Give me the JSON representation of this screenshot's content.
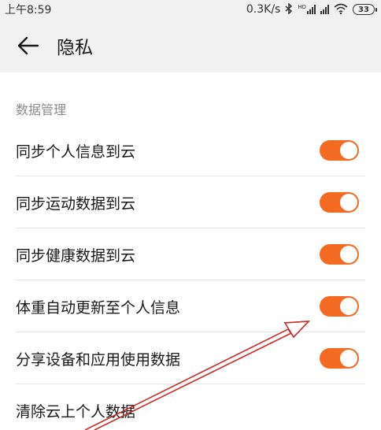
{
  "status_bar": {
    "time": "上午8:59",
    "network_speed": "0.3K/s",
    "bluetooth_icon": "bluetooth-icon",
    "hd_label": "HD",
    "wifi_icon": "wifi-icon",
    "battery_level": "33"
  },
  "app_bar": {
    "back_icon": "back-arrow-icon",
    "title": "隐私"
  },
  "section": {
    "header": "数据管理",
    "items": [
      {
        "label": "同步个人信息到云",
        "toggle_on": true
      },
      {
        "label": "同步运动数据到云",
        "toggle_on": true
      },
      {
        "label": "同步健康数据到云",
        "toggle_on": true
      },
      {
        "label": "体重自动更新至个人信息",
        "toggle_on": true
      },
      {
        "label": "分享设备和应用使用数据",
        "toggle_on": true
      },
      {
        "label": "清除云上个人数据"
      }
    ]
  },
  "colors": {
    "accent": "#f36a22",
    "annotation_arrow": "#c9302c"
  }
}
